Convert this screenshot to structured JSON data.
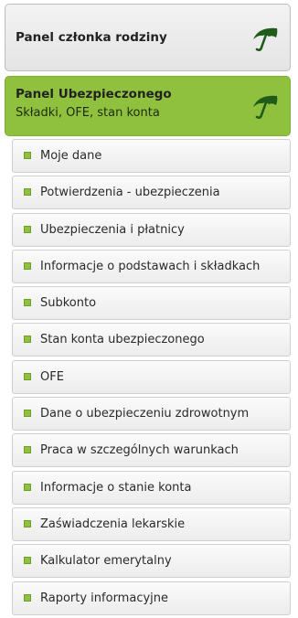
{
  "panels": {
    "family": {
      "title": "Panel członka rodziny"
    },
    "insured": {
      "title": "Panel Ubezpieczonego",
      "subtitle": "Składki, OFE, stan konta"
    }
  },
  "menu": {
    "items": [
      {
        "label": "Moje dane"
      },
      {
        "label": "Potwierdzenia - ubezpieczenia"
      },
      {
        "label": "Ubezpieczenia i płatnicy"
      },
      {
        "label": "Informacje o podstawach i składkach"
      },
      {
        "label": "Subkonto"
      },
      {
        "label": "Stan konta ubezpieczonego"
      },
      {
        "label": "OFE"
      },
      {
        "label": "Dane o ubezpieczeniu zdrowotnym"
      },
      {
        "label": "Praca w szczególnych warunkach"
      },
      {
        "label": "Informacje o stanie konta"
      },
      {
        "label": "Zaświadczenia lekarskie"
      },
      {
        "label": "Kalkulator emerytalny"
      },
      {
        "label": "Raporty informacyjne"
      }
    ]
  },
  "icons": {
    "panel_icon": "umbrella-icon",
    "bullet_icon": "square-bullet-icon"
  },
  "colors": {
    "accent": "#8fc13f",
    "icon_dark": "#1f5c1a"
  }
}
